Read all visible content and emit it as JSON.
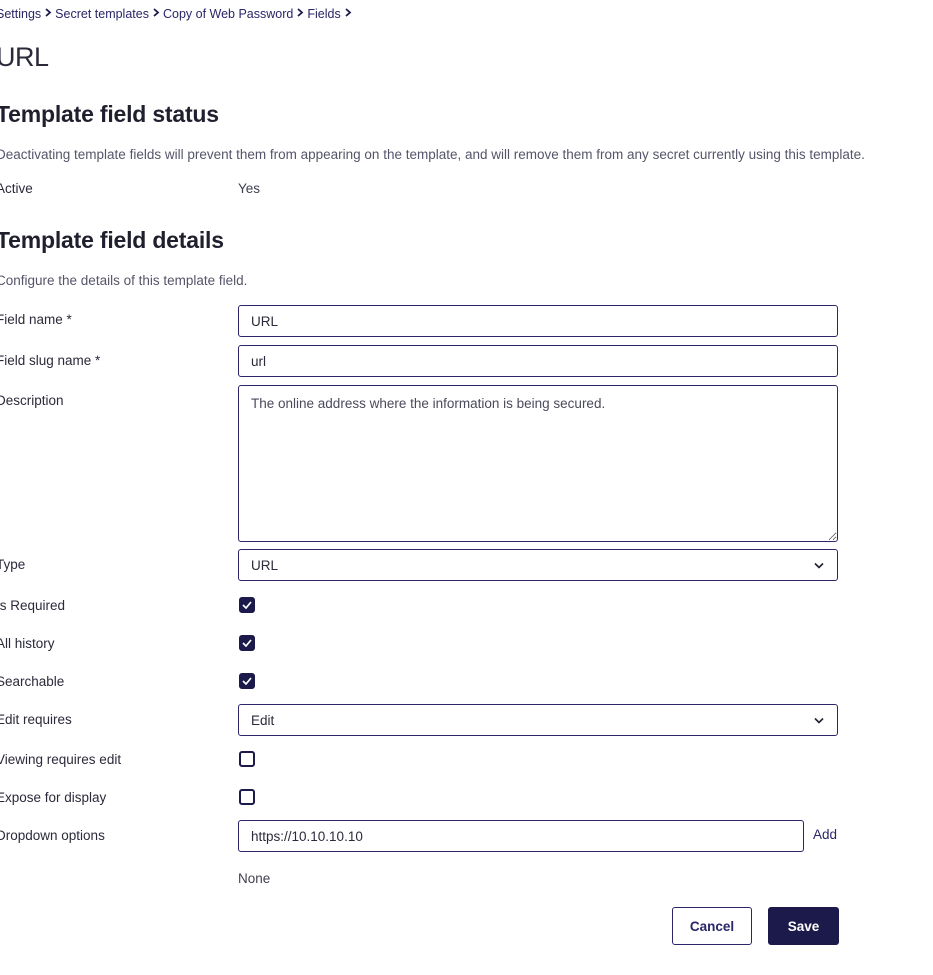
{
  "breadcrumb": {
    "items": [
      "Settings",
      "Secret templates",
      "Copy of Web Password",
      "Fields"
    ]
  },
  "page_title": "URL",
  "status_section": {
    "title": "Template field status",
    "help": "Deactivating template fields will prevent them from appearing on the template, and will remove them from any secret currently using this template.",
    "active_label": "Active",
    "active_value": "Yes"
  },
  "details_section": {
    "title": "Template field details",
    "help": "Configure the details of this template field.",
    "field_name": {
      "label": "Field name *",
      "value": "URL"
    },
    "field_slug": {
      "label": "Field slug name *",
      "value": "url"
    },
    "description": {
      "label": "Description",
      "value": "The online address where the information is being secured."
    },
    "type": {
      "label": "Type",
      "value": "URL"
    },
    "is_required": {
      "label": "Is Required",
      "checked": true
    },
    "all_history": {
      "label": "All history",
      "checked": true
    },
    "searchable": {
      "label": "Searchable",
      "checked": true
    },
    "edit_requires": {
      "label": "Edit requires",
      "value": "Edit"
    },
    "viewing_requires_edit": {
      "label": "Viewing requires edit",
      "checked": false
    },
    "expose_for_display": {
      "label": "Expose for display",
      "checked": false
    },
    "dropdown_options": {
      "label": "Dropdown options",
      "value": "https://10.10.10.10",
      "add_label": "Add",
      "empty_text": "None"
    }
  },
  "actions": {
    "cancel_label": "Cancel",
    "save_label": "Save"
  },
  "colors": {
    "accent": "#1c1a4a",
    "link": "#2a2668"
  }
}
